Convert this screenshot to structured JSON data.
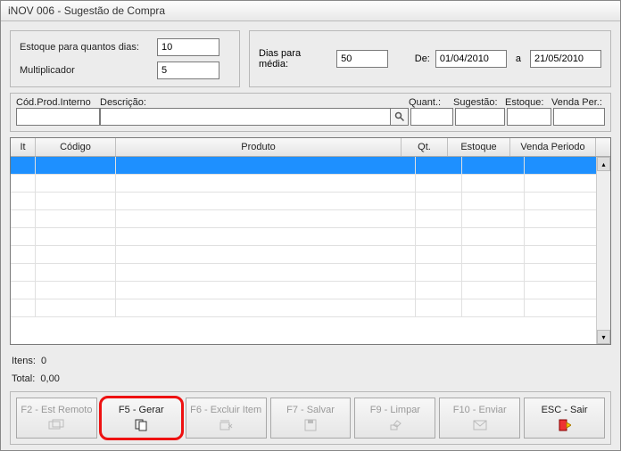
{
  "window": {
    "title": "iNOV 006 - Sugestão de Compra"
  },
  "leftPanel": {
    "estoqueDiasLabel": "Estoque para quantos dias:",
    "estoqueDiasValue": "10",
    "multiplicadorLabel": "Multiplicador",
    "multiplicadorValue": "5"
  },
  "rightPanel": {
    "diasMediaLabel": "Dias para média:",
    "diasMediaValue": "50",
    "deLabel": "De:",
    "deValue": "01/04/2010",
    "aLabel": "a",
    "aValue": "21/05/2010"
  },
  "filters": {
    "codLabel": "Cód.Prod.Interno",
    "descLabel": "Descrição:",
    "quantLabel": "Quant.:",
    "sugestaoLabel": "Sugestão:",
    "estoqueLabel": "Estoque:",
    "vendaPerLabel": "Venda Per.:",
    "codValue": "",
    "descValue": "",
    "quantValue": "",
    "sugestaoValue": "",
    "estoqueValue": "",
    "vendaPerValue": ""
  },
  "grid": {
    "headers": {
      "it": "It",
      "codigo": "Código",
      "produto": "Produto",
      "qt": "Qt.",
      "estoque": "Estoque",
      "vendaPeriodo": "Venda Periodo"
    }
  },
  "status": {
    "itensLabel": "Itens:",
    "itensValue": "0",
    "totalLabel": "Total:",
    "totalValue": "0,00"
  },
  "buttons": {
    "f2": "F2 - Est Remoto",
    "f5": "F5 - Gerar",
    "f6": "F6 - Excluir Item",
    "f7": "F7 - Salvar",
    "f9": "F9 - Limpar",
    "f10": "F10 - Enviar",
    "esc": "ESC - Sair"
  }
}
